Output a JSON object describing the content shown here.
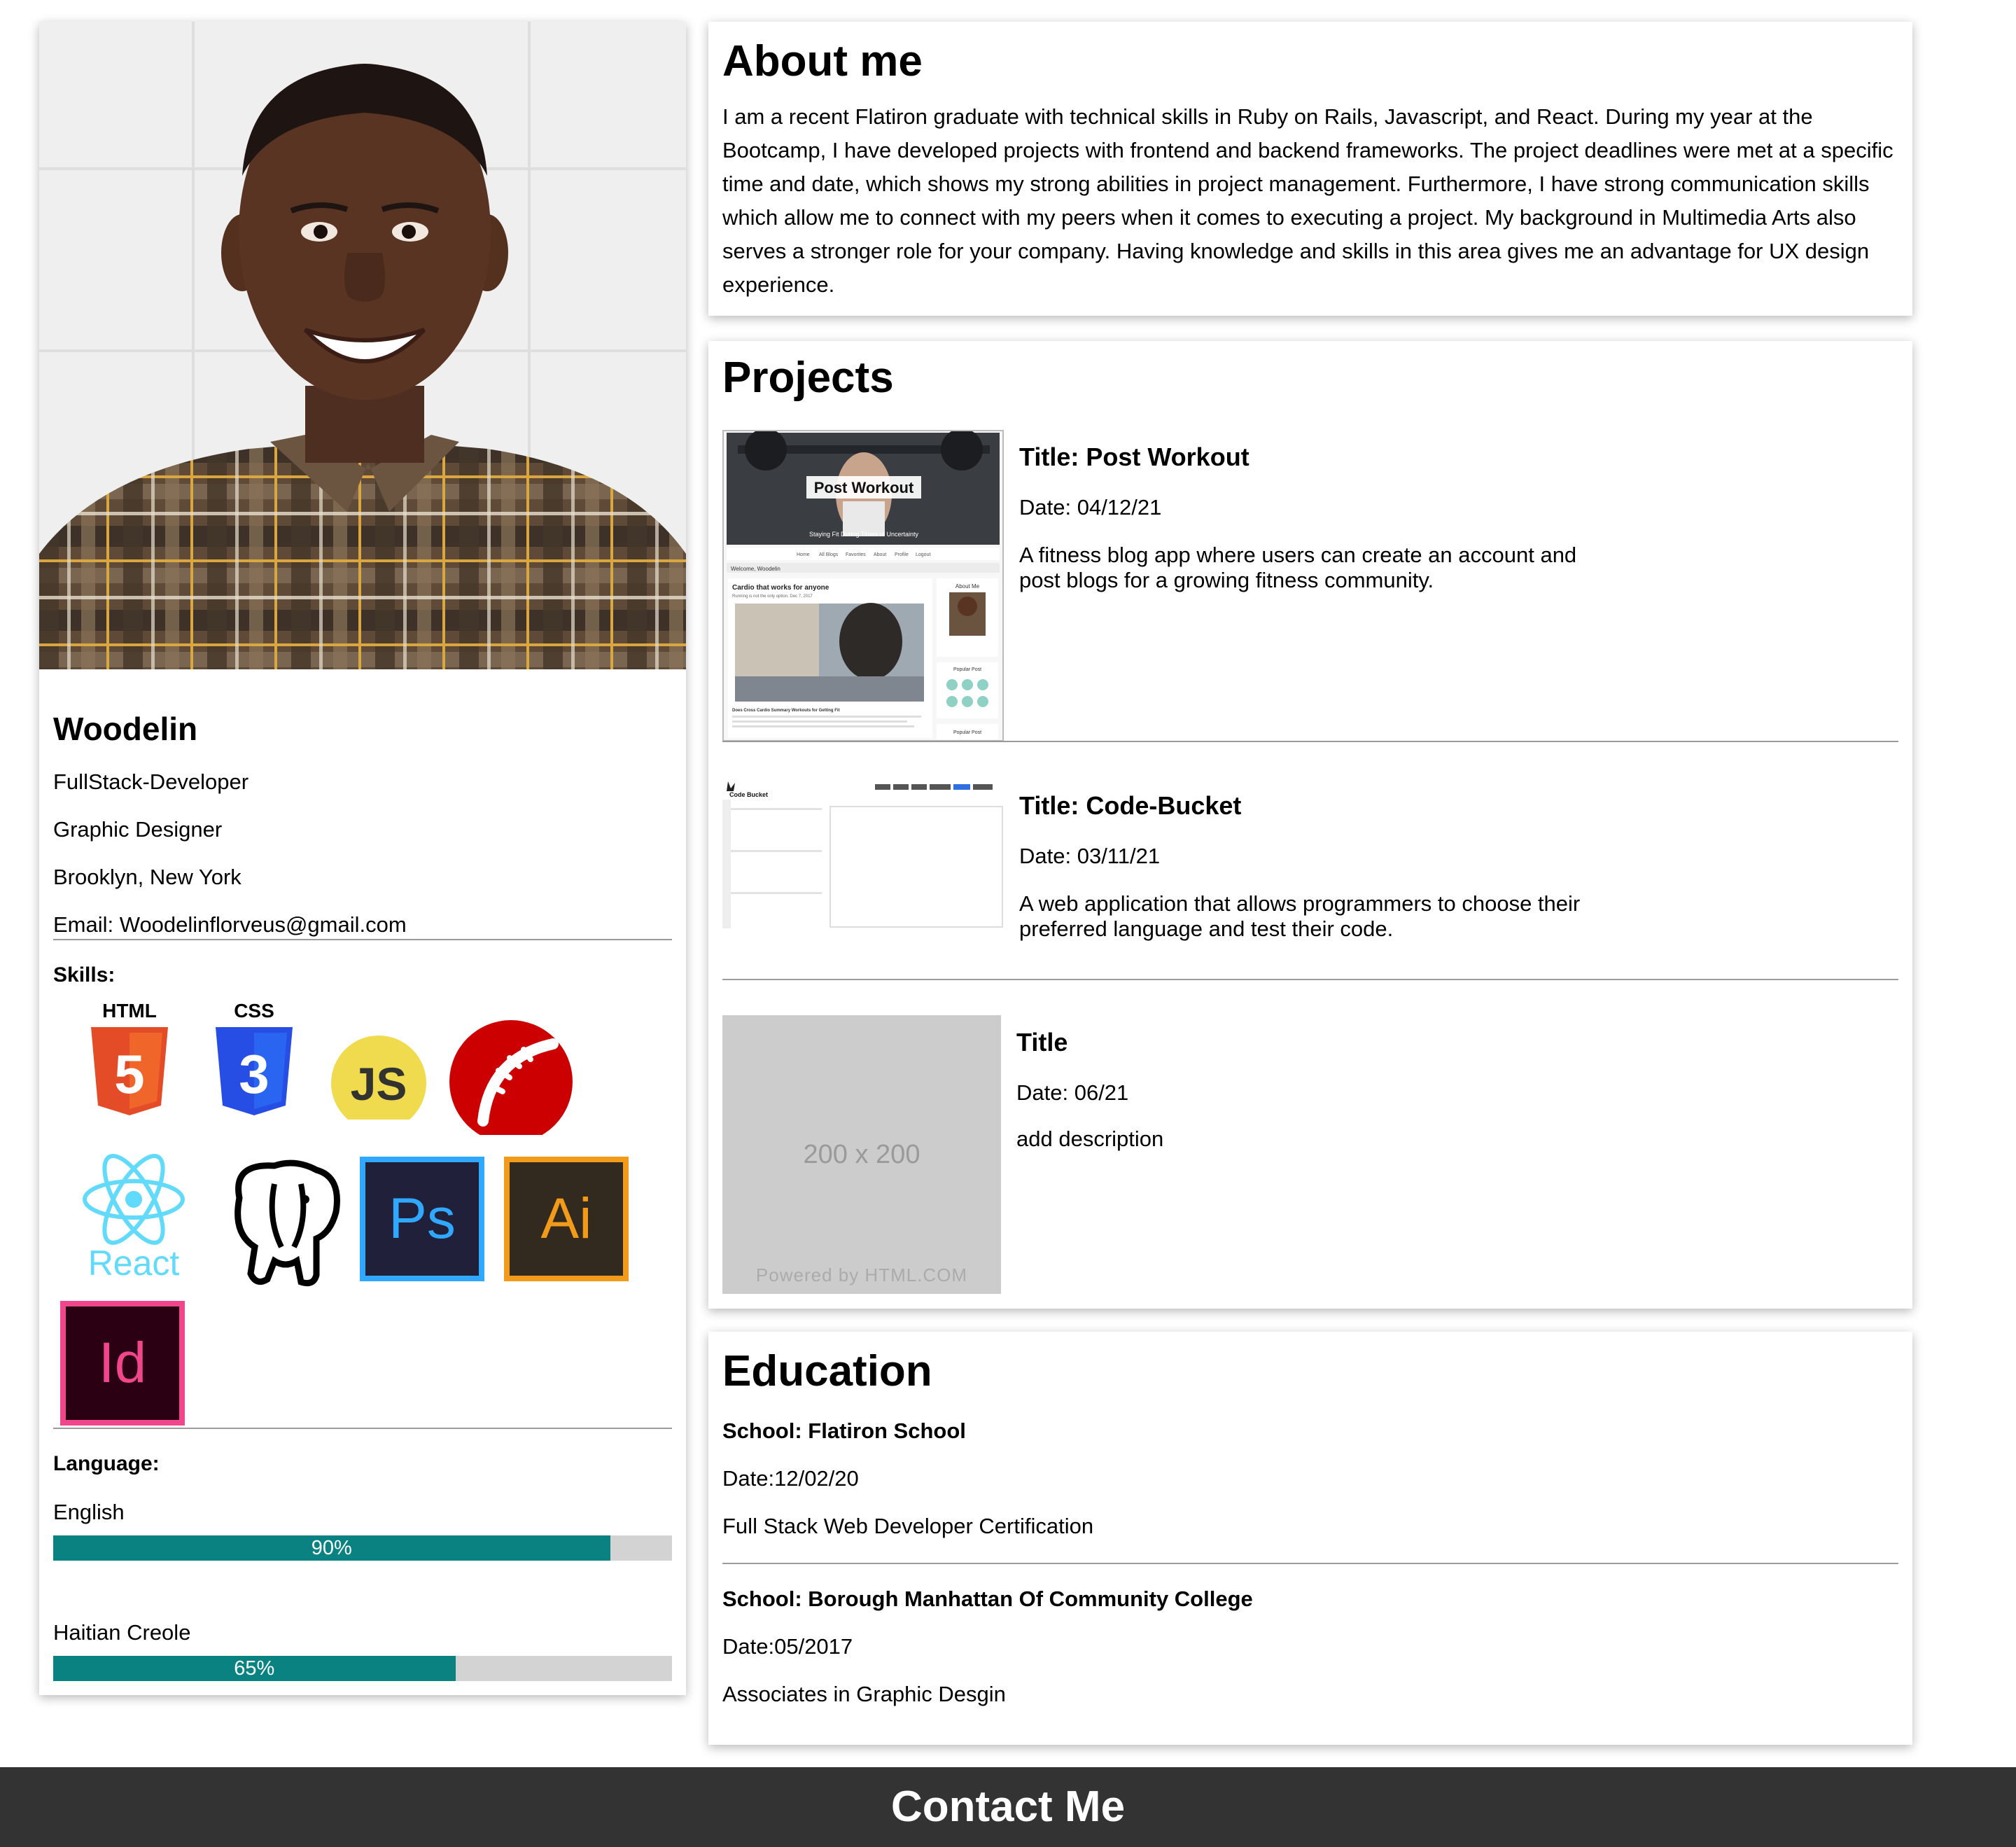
{
  "profile": {
    "name": "Woodelin",
    "role1": "FullStack-Developer",
    "role2": "Graphic Designer",
    "location": "Brooklyn, New York",
    "email": "Email: Woodelinflorveus@gmail.com",
    "skills_label": "Skills:",
    "skills": [
      {
        "icon": "html5-icon",
        "caption": "HTML",
        "glyph": "5"
      },
      {
        "icon": "css3-icon",
        "caption": "CSS",
        "glyph": "3"
      },
      {
        "icon": "javascript-icon",
        "glyph": "JS"
      },
      {
        "icon": "rails-icon"
      },
      {
        "icon": "react-icon",
        "caption": "React"
      },
      {
        "icon": "postgresql-icon"
      },
      {
        "icon": "photoshop-icon",
        "glyph": "Ps"
      },
      {
        "icon": "illustrator-icon",
        "glyph": "Ai"
      },
      {
        "icon": "indesign-icon",
        "glyph": "Id"
      }
    ],
    "language_label": "Language:",
    "languages": [
      {
        "name": "English",
        "percent": 90,
        "label": "90%"
      },
      {
        "name": "Haitian Creole",
        "percent": 65,
        "label": "65%"
      }
    ]
  },
  "about": {
    "heading": "About me",
    "text": "I am a recent Flatiron graduate with technical skills in Ruby on Rails, Javascript, and React. During my year at the Bootcamp, I have developed projects with frontend and backend frameworks. The project deadlines were met at a specific time and date, which shows my strong abilities in project management. Furthermore, I have strong communication skills which allow me to connect with my peers when it comes to executing a project. My background in Multimedia Arts also serves a stronger role for your company. Having knowledge and skills in this area gives me an advantage for UX design experience."
  },
  "projects": {
    "heading": "Projects",
    "items": [
      {
        "title": "Title: Post Workout",
        "date": "Date: 04/12/21",
        "description": "A fitness blog app where users can create an account and post blogs for a growing fitness community.",
        "thumb": {
          "overlay": "Post Workout",
          "tagline": "Staying Fit During Times of Uncertainty",
          "welcome": "Welcome, Woodelin",
          "post_title": "Cardio that works for anyone",
          "post_sub": "Running is not the only option. Dec 7, 2017",
          "post_caption": "Does Cross Cardio Summary Workouts for Getting Fit",
          "side_about": "About Me",
          "side_popular": "Popular Post",
          "side_popular2": "Popular Post",
          "nav": [
            "Home",
            "All Blogs",
            "Favorites",
            "About",
            "Profile",
            "Logout"
          ]
        }
      },
      {
        "title": "Title: Code-Bucket",
        "date": "Date: 03/11/21",
        "description": "A web application that allows programmers to choose their preferred language and test their code.",
        "thumb": {
          "logo": "Code Bucket"
        }
      },
      {
        "title": "Title",
        "date": "Date: 06/21",
        "description": "add description",
        "thumb": {
          "placeholder": "200 x 200",
          "powered": "Powered by HTML.COM"
        }
      }
    ]
  },
  "education": {
    "heading": "Education",
    "items": [
      {
        "school": "School: Flatiron School",
        "date": "Date:12/02/20",
        "credential": "Full Stack Web Developer Certification"
      },
      {
        "school": "School: Borough Manhattan Of Community College",
        "date": "Date:05/2017",
        "credential": "Associates in Graphic Desgin"
      }
    ]
  },
  "footer": {
    "label": "Contact Me"
  },
  "colors": {
    "progress": "#0a8282",
    "track": "#d3d3d3",
    "footer": "#333333"
  }
}
